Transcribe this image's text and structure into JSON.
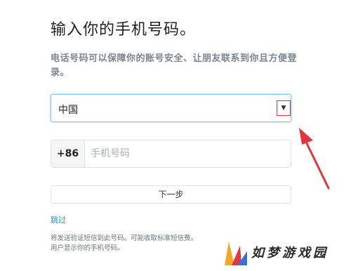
{
  "header": {
    "title": "输入你的手机号码。",
    "subtitle": "电话号码可以保障你的账号安全、让朋友联系到你且方便登录。"
  },
  "form": {
    "country": {
      "selected": "中国",
      "arrow_icon": "caret-down-icon"
    },
    "phone": {
      "country_code": "+86",
      "placeholder": "手机号码",
      "value": ""
    },
    "next_button_label": "下一步",
    "skip_label": "跳过"
  },
  "notice": {
    "line1": "将发送验证短信到此号码。可能收取标准短信费。",
    "line2": "用户显示你的手机号码。"
  },
  "annotation": {
    "arrow_color": "#e0363c",
    "highlight_color": "#e0363c"
  },
  "watermark": {
    "text": "如梦游戏园",
    "logo_colors": [
      "#f5a623",
      "#e0363c",
      "#3b6fd8"
    ]
  },
  "colors": {
    "focus_border": "#8ec3ea",
    "link": "#1b95e0",
    "muted_text": "#7a8790"
  }
}
